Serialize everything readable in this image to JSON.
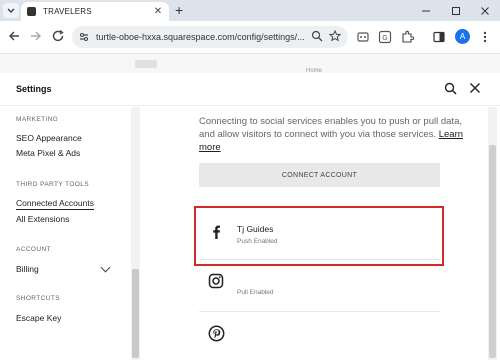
{
  "browser": {
    "tab_title": "TRAVELERS",
    "tab_close": "✕",
    "new_tab": "+",
    "url": "turtle-oboe-hxxa.squarespace.com/config/settings/...",
    "avatar_letter": "A"
  },
  "page_behind": {
    "home_label": "Home"
  },
  "settings": {
    "title": "Settings",
    "sidebar": {
      "sections": [
        {
          "heading": "MARKETING",
          "items": [
            "SEO Appearance",
            "Meta Pixel & Ads"
          ]
        },
        {
          "heading": "THIRD PARTY TOOLS",
          "items": [
            "Connected Accounts",
            "All Extensions"
          ]
        },
        {
          "heading": "ACCOUNT",
          "items": [
            "Billing"
          ]
        },
        {
          "heading": "SHORTCUTS",
          "items": [
            "Escape Key"
          ]
        }
      ],
      "active_item": "Connected Accounts"
    },
    "main": {
      "intro_text": "Connecting to social services enables you to push or pull data, and allow visitors to connect with you via those services.",
      "learn_more": "Learn more",
      "connect_button": "CONNECT ACCOUNT",
      "accounts": [
        {
          "icon": "facebook-icon",
          "name": "Tj Guides",
          "status": "Push Enabled"
        },
        {
          "icon": "instagram-icon",
          "name": "",
          "status": "Pull Enabled"
        },
        {
          "icon": "pinterest-icon",
          "name": "",
          "status": ""
        }
      ],
      "highlight_color": "#d12a2a"
    }
  }
}
